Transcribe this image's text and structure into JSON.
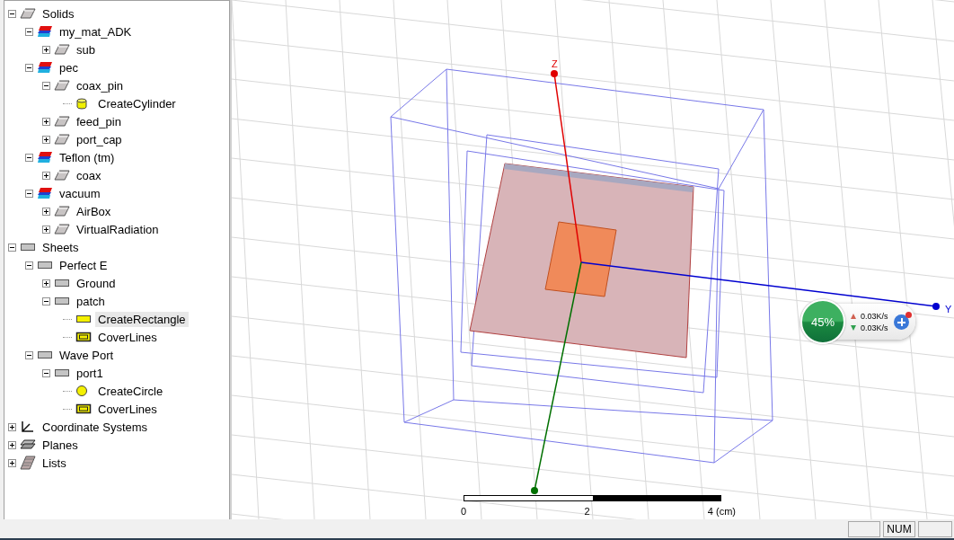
{
  "tree": [
    {
      "label": "Solids",
      "kind": "solid",
      "expanded": true,
      "selected": false,
      "children": [
        {
          "label": "my_mat_ADK",
          "kind": "material",
          "expanded": true,
          "selected": false,
          "children": [
            {
              "label": "sub",
              "kind": "solid",
              "expanded": false,
              "selected": false
            }
          ]
        },
        {
          "label": "pec",
          "kind": "material",
          "expanded": true,
          "selected": false,
          "children": [
            {
              "label": "coax_pin",
              "kind": "solid",
              "expanded": true,
              "selected": false,
              "children": [
                {
                  "label": "CreateCylinder",
                  "kind": "cylinder",
                  "selected": false
                }
              ]
            },
            {
              "label": "feed_pin",
              "kind": "solid",
              "expanded": false,
              "selected": false
            },
            {
              "label": "port_cap",
              "kind": "solid",
              "expanded": false,
              "selected": false
            }
          ]
        },
        {
          "label": "Teflon (tm)",
          "kind": "material",
          "expanded": true,
          "selected": false,
          "children": [
            {
              "label": "coax",
              "kind": "solid",
              "expanded": false,
              "selected": false
            }
          ]
        },
        {
          "label": "vacuum",
          "kind": "material",
          "expanded": true,
          "selected": false,
          "children": [
            {
              "label": "AirBox",
              "kind": "solid",
              "expanded": false,
              "selected": false
            },
            {
              "label": "VirtualRadiation",
              "kind": "solid",
              "expanded": false,
              "selected": false
            }
          ]
        }
      ]
    },
    {
      "label": "Sheets",
      "kind": "sheet",
      "expanded": true,
      "selected": false,
      "children": [
        {
          "label": "Perfect E",
          "kind": "sheet",
          "expanded": true,
          "selected": false,
          "children": [
            {
              "label": "Ground",
              "kind": "sheet",
              "expanded": false,
              "selected": false
            },
            {
              "label": "patch",
              "kind": "sheet",
              "expanded": true,
              "selected": false,
              "children": [
                {
                  "label": "CreateRectangle",
                  "kind": "rectangle",
                  "selected": true
                },
                {
                  "label": "CoverLines",
                  "kind": "coverlines",
                  "selected": false
                }
              ]
            }
          ]
        },
        {
          "label": "Wave Port",
          "kind": "sheet",
          "expanded": true,
          "selected": false,
          "children": [
            {
              "label": "port1",
              "kind": "sheet",
              "expanded": true,
              "selected": false,
              "children": [
                {
                  "label": "CreateCircle",
                  "kind": "circle",
                  "selected": false
                },
                {
                  "label": "CoverLines",
                  "kind": "coverlines",
                  "selected": false
                }
              ]
            }
          ]
        }
      ]
    },
    {
      "label": "Coordinate Systems",
      "kind": "coords",
      "expanded": false,
      "selected": false
    },
    {
      "label": "Planes",
      "kind": "planes",
      "expanded": false,
      "selected": false
    },
    {
      "label": "Lists",
      "kind": "lists",
      "expanded": false,
      "selected": false
    }
  ],
  "viewport": {
    "axes": [
      {
        "kind": "z",
        "label": "Z"
      },
      {
        "kind": "y",
        "label": "Y"
      },
      {
        "kind": "x"
      }
    ],
    "scale_bar": {
      "labels": [
        "0",
        "2",
        "4 (cm)"
      ]
    }
  },
  "speed_widget": {
    "percent": "45%",
    "upload": "0.03K/s",
    "download": "0.03K/s"
  },
  "status_bar": {
    "panels": [
      "NUM"
    ]
  }
}
